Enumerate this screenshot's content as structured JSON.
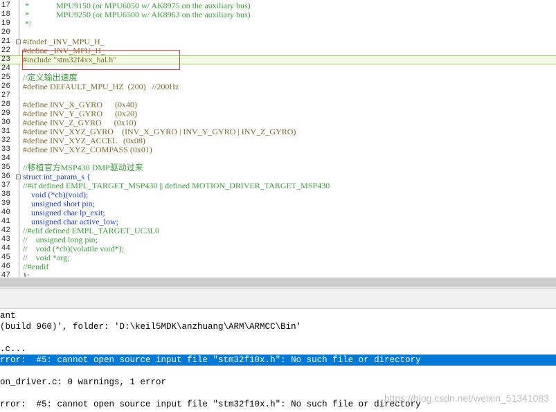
{
  "editor": {
    "lines": [
      {
        "num": "17",
        "text": " *             MPU9150 (or MPU6050 w/ AK8975 on the auxiliary bus)",
        "cls": "t-comment"
      },
      {
        "num": "18",
        "text": " *             MPU9250 (or MPU6500 w/ AK8963 on the auxiliary bus)",
        "cls": "t-comment"
      },
      {
        "num": "19",
        "text": " */",
        "cls": "t-comment"
      },
      {
        "num": "20",
        "text": "",
        "cls": ""
      },
      {
        "num": "21",
        "text": "#ifndef _INV_MPU_H_",
        "cls": "t-pre",
        "fold": "-"
      },
      {
        "num": "22",
        "text": "#define _INV_MPU_H_",
        "cls": "t-pre"
      },
      {
        "num": "23",
        "text": "#include \"stm32f4xx_hal.h\"",
        "cls": "t-pre",
        "current": true
      },
      {
        "num": "24",
        "text": "",
        "cls": ""
      },
      {
        "num": "25",
        "text": "//定义输出速度",
        "cls": "t-comment"
      },
      {
        "num": "26",
        "text": "#define DEFAULT_MPU_HZ  (200)   //200Hz",
        "cls": "t-pre"
      },
      {
        "num": "27",
        "text": "",
        "cls": ""
      },
      {
        "num": "28",
        "text": "#define INV_X_GYRO      (0x40)",
        "cls": "t-pre"
      },
      {
        "num": "29",
        "text": "#define INV_Y_GYRO      (0x20)",
        "cls": "t-pre"
      },
      {
        "num": "30",
        "text": "#define INV_Z_GYRO      (0x10)",
        "cls": "t-pre"
      },
      {
        "num": "31",
        "text": "#define INV_XYZ_GYRO    (INV_X_GYRO | INV_Y_GYRO | INV_Z_GYRO)",
        "cls": "t-pre"
      },
      {
        "num": "32",
        "text": "#define INV_XYZ_ACCEL   (0x08)",
        "cls": "t-pre"
      },
      {
        "num": "33",
        "text": "#define INV_XYZ_COMPASS (0x01)",
        "cls": "t-pre"
      },
      {
        "num": "34",
        "text": "",
        "cls": ""
      },
      {
        "num": "35",
        "text": "//移植官方MSP430 DMP驱动过来",
        "cls": "t-comment"
      },
      {
        "num": "36",
        "text": "struct int_param_s {",
        "cls": "t-kw",
        "fold": "-"
      },
      {
        "num": "37",
        "text": "//#if defined EMPL_TARGET_MSP430 || defined MOTION_DRIVER_TARGET_MSP430",
        "cls": "t-comment"
      },
      {
        "num": "38",
        "text": "    void (*cb)(void);",
        "cls": "t-kw"
      },
      {
        "num": "39",
        "text": "    unsigned short pin;",
        "cls": "t-kw"
      },
      {
        "num": "40",
        "text": "    unsigned char lp_exit;",
        "cls": "t-kw"
      },
      {
        "num": "41",
        "text": "    unsigned char active_low;",
        "cls": "t-kw"
      },
      {
        "num": "42",
        "text": "//#elif defined EMPL_TARGET_UC3L0",
        "cls": "t-comment"
      },
      {
        "num": "43",
        "text": "//    unsigned long pin;",
        "cls": "t-comment"
      },
      {
        "num": "44",
        "text": "//    void (*cb)(volatile void*);",
        "cls": "t-comment"
      },
      {
        "num": "45",
        "text": "//    void *arg;",
        "cls": "t-comment"
      },
      {
        "num": "46",
        "text": "//#endif",
        "cls": "t-comment"
      },
      {
        "num": "47",
        "text": "};",
        "cls": ""
      }
    ]
  },
  "output": {
    "lines": [
      {
        "text": "ant",
        "selected": false
      },
      {
        "text": "(build 960)', folder: 'D:\\keil5MDK\\anzhuang\\ARM\\ARMCC\\Bin'",
        "selected": false
      },
      {
        "text": "",
        "selected": false
      },
      {
        "text": ".c...",
        "selected": false
      },
      {
        "text": "rror:  #5: cannot open source input file \"stm32f10x.h\": No such file or directory",
        "selected": true
      },
      {
        "text": "",
        "selected": false
      },
      {
        "text": "on_driver.c: 0 warnings, 1 error",
        "selected": false
      },
      {
        "text": "",
        "selected": false
      },
      {
        "text": "rror:  #5: cannot open source input file \"stm32f10x.h\": No such file or directory",
        "selected": false
      }
    ]
  },
  "watermark": "https://blog.csdn.net/weixin_51341083"
}
